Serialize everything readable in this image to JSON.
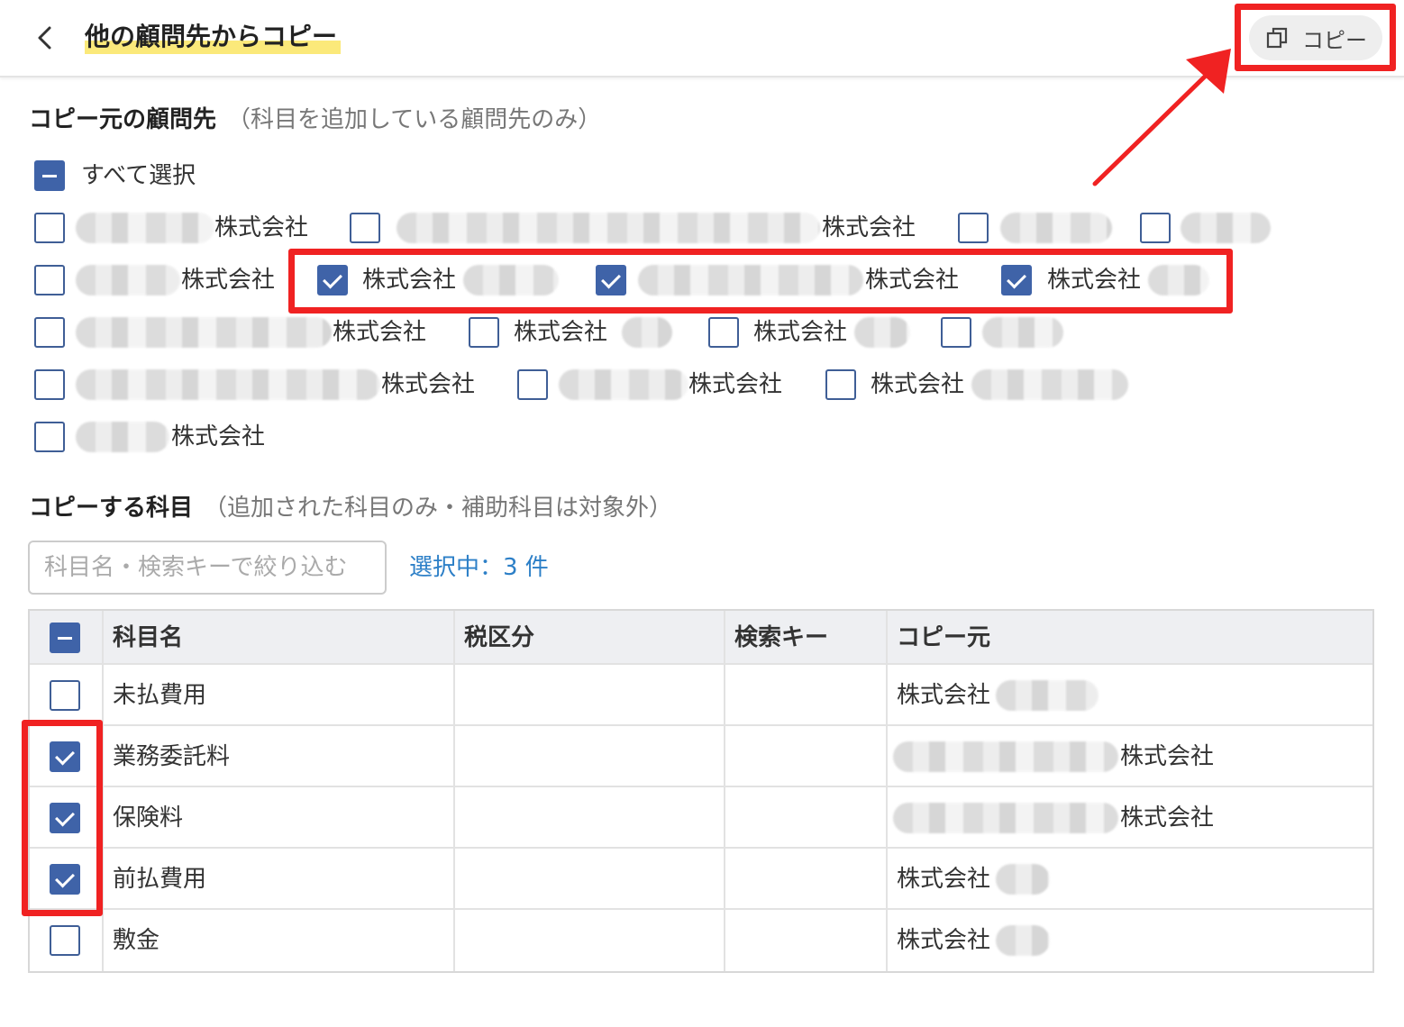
{
  "header": {
    "title": "他の顧問先からコピー",
    "copy_button_label": "コピー"
  },
  "source_section": {
    "title": "コピー元の顧問先",
    "note": "（科目を追加している顧問先のみ）",
    "select_all_label": "すべて選択",
    "companies": [
      {
        "label": "株式会社",
        "checked": false
      },
      {
        "label": "株式会社",
        "checked": false
      },
      {
        "label": "",
        "checked": false
      },
      {
        "label": "",
        "checked": false
      },
      {
        "label": "株式会社",
        "checked": false
      },
      {
        "label": "株式会社",
        "checked": true
      },
      {
        "label": "株式会社",
        "checked": true
      },
      {
        "label": "株式会社",
        "checked": true
      },
      {
        "label": "株式会社",
        "checked": false
      },
      {
        "label": "株式会社",
        "checked": false
      },
      {
        "label": "株式会社",
        "checked": false
      },
      {
        "label": "",
        "checked": false
      },
      {
        "label": "株式会社",
        "checked": false
      },
      {
        "label": "株式会社",
        "checked": false
      },
      {
        "label": "株式会社",
        "checked": false
      },
      {
        "label": "株式会社",
        "checked": false
      }
    ]
  },
  "accounts_section": {
    "title": "コピーする科目",
    "note": "（追加された科目のみ・補助科目は対象外）",
    "filter_placeholder": "科目名・検索キーで絞り込む",
    "filter_value": "",
    "selected_count": "選択中：3 件"
  },
  "table": {
    "columns": [
      "科目名",
      "税区分",
      "検索キー",
      "コピー元"
    ],
    "rows": [
      {
        "checked": false,
        "name": "未払費用",
        "tax": "",
        "key": "",
        "source": "株式会社"
      },
      {
        "checked": true,
        "name": "業務委託料",
        "tax": "",
        "key": "",
        "source": "株式会社"
      },
      {
        "checked": true,
        "name": "保険料",
        "tax": "",
        "key": "",
        "source": "株式会社"
      },
      {
        "checked": true,
        "name": "前払費用",
        "tax": "",
        "key": "",
        "source": "株式会社"
      },
      {
        "checked": false,
        "name": "敷金",
        "tax": "",
        "key": "",
        "source": "株式会社"
      }
    ]
  },
  "colors": {
    "checkbox_accent": "#3f63a8",
    "link": "#2c7fc7",
    "title_highlight": "#fbe97a",
    "annotation_red": "#f02222"
  }
}
